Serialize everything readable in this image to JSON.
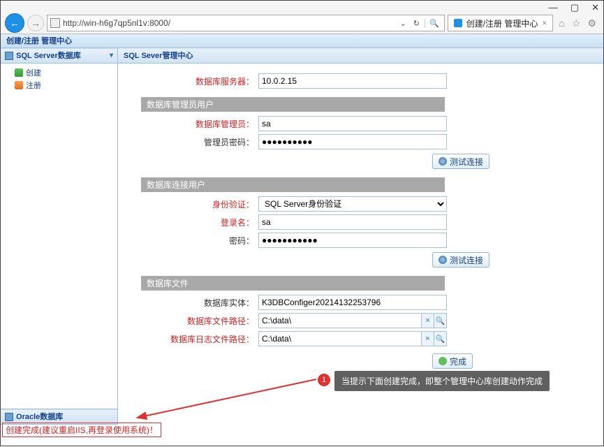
{
  "window": {
    "minimize": "—",
    "maximize": "▢",
    "close": "✕"
  },
  "browser": {
    "url": "http://win-h6g7qp5nl1v:8000/",
    "search_hint": "⌄",
    "refresh": "↻",
    "search_btn": "🔍",
    "tab_title": "创建/注册 管理中心",
    "tab_close": "×",
    "home": "⌂",
    "star": "☆",
    "gear": "⚙"
  },
  "appbar": {
    "title": "创建/注册 管理中心"
  },
  "sidebar": {
    "panel1_title": "SQL Server数据库",
    "collapse": "▾",
    "tree": {
      "create": "创建",
      "register": "注册"
    },
    "panel2_title": "Oracle数据库"
  },
  "content": {
    "title": "SQL Sever管理中心",
    "server_label": "数据库服务器：",
    "server_value": "10.0.2.15",
    "section_admin": "数据库管理员用户",
    "admin_label": "数据库管理员：",
    "admin_value": "sa",
    "admin_pwd_label": "管理员密码：",
    "admin_pwd_value": "●●●●●●●●●●",
    "btn_test": "测试连接",
    "section_conn": "数据库连接用户",
    "auth_label": "身份验证：",
    "auth_value": "SQL Server身份验证",
    "login_label": "登录名：",
    "login_value": "sa",
    "pwd_label": "密码：",
    "pwd_value": "●●●●●●●●●●●",
    "section_files": "数据库文件",
    "entity_label": "数据库实体：",
    "entity_value": "K3DBConfiger20214132253796",
    "filepath_label": "数据库文件路径：",
    "filepath_value": "C:\\data\\",
    "logpath_label": "数据库日志文件路径：",
    "logpath_value": "C:\\data\\",
    "clear": "×",
    "browse": "🔍",
    "btn_finish": "完成"
  },
  "status": {
    "text": "创建完成(建议重启IIS,再登录使用系统)！"
  },
  "annotation": {
    "num": "1",
    "text": "当提示下面创建完成，即整个管理中心库创建动作完成"
  }
}
